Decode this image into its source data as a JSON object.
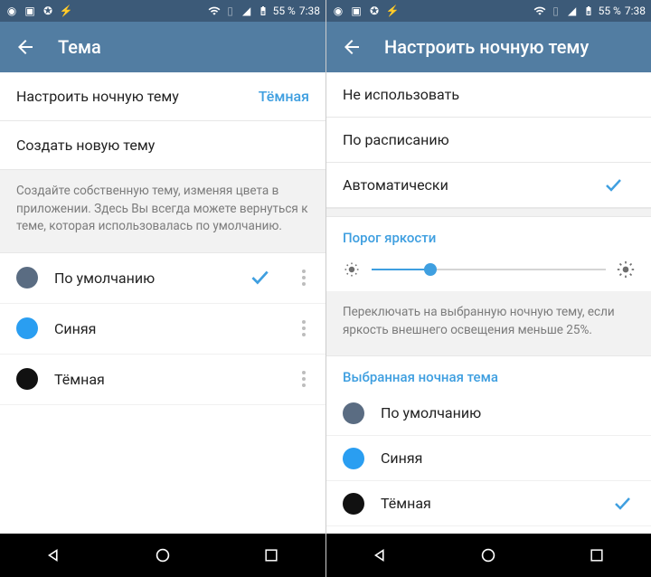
{
  "status": {
    "battery": "55 %",
    "time": "7:38"
  },
  "left": {
    "title": "Тема",
    "night_label": "Настроить ночную тему",
    "night_value": "Тёмная",
    "create_label": "Создать новую тему",
    "info": "Создайте собственную тему, изменяя цвета в приложении. Здесь Вы всегда можете вернуться к теме, которая использовалась по умолчанию.",
    "themes": [
      {
        "name": "По умолчанию",
        "selected": true
      },
      {
        "name": "Синяя",
        "selected": false
      },
      {
        "name": "Тёмная",
        "selected": false
      }
    ]
  },
  "right": {
    "title": "Настроить ночную тему",
    "options": {
      "none": "Не использовать",
      "schedule": "По расписанию",
      "auto": "Автоматически"
    },
    "brightness_section": "Порог яркости",
    "brightness_percent": 25,
    "brightness_hint": "Переключать на выбранную ночную тему, если яркость внешнего освещения меньше 25%.",
    "selected_section": "Выбранная ночная тема",
    "themes": [
      {
        "name": "По умолчанию",
        "selected": false
      },
      {
        "name": "Синяя",
        "selected": false
      },
      {
        "name": "Тёмная",
        "selected": true
      }
    ]
  }
}
